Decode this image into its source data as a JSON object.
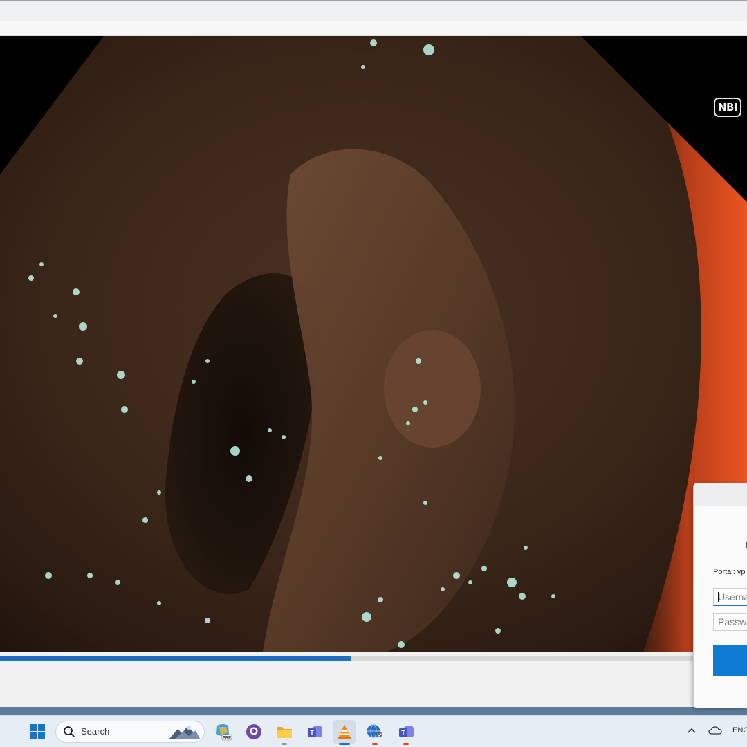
{
  "window": {
    "title": "",
    "background": "#eef0f2"
  },
  "video": {
    "overlay_badge": "NBI",
    "progress": 0.505,
    "accent_color": "#1f6fc4"
  },
  "vpn_dialog": {
    "portal_label": "Portal: vp",
    "username_placeholder": "Username",
    "password_placeholder": "Password",
    "connect_button_color": "#0f7ad1"
  },
  "taskbar": {
    "search_placeholder": "Search",
    "apps": [
      {
        "name": "start-button",
        "icon": "windows-logo-icon"
      },
      {
        "name": "copilot-preview",
        "icon": "copilot-icon",
        "badge": "PRE"
      },
      {
        "name": "github-desktop",
        "icon": "github-icon"
      },
      {
        "name": "file-explorer",
        "icon": "folder-icon"
      },
      {
        "name": "teams-classic",
        "icon": "teams-icon"
      },
      {
        "name": "vlc-player",
        "icon": "vlc-cone-icon",
        "active": true
      },
      {
        "name": "vpn-client",
        "icon": "globe-shield-icon",
        "running": true
      },
      {
        "name": "teams-new",
        "icon": "teams-icon",
        "running": true
      }
    ],
    "language": "ENG"
  }
}
